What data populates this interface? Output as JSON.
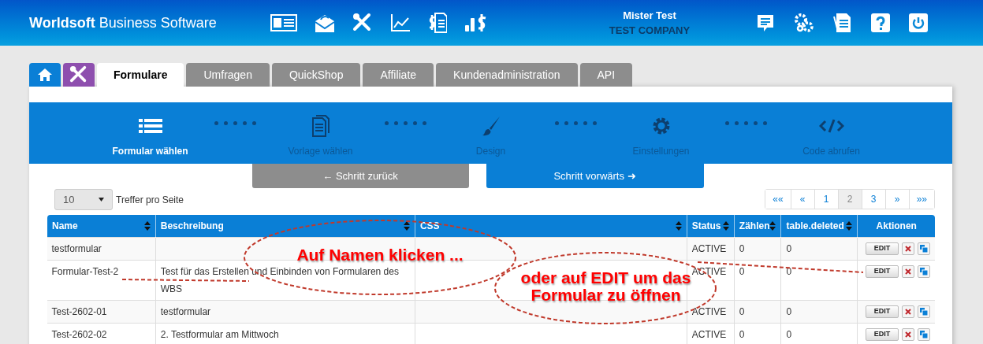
{
  "header": {
    "title": "**Worldsoft** Business Software",
    "user_name": "Mister Test",
    "company": "TEST COMPANY"
  },
  "tabs": [
    {
      "kind": "home",
      "selected": false
    },
    {
      "kind": "tools",
      "selected": false
    },
    {
      "kind": "text",
      "label": "Formulare",
      "selected": true
    },
    {
      "kind": "text",
      "label": "Umfragen",
      "selected": false
    },
    {
      "kind": "text",
      "label": "QuickShop",
      "selected": false
    },
    {
      "kind": "text",
      "label": "Affiliate",
      "selected": false
    },
    {
      "kind": "text",
      "label": "Kundenadministration",
      "selected": false
    },
    {
      "kind": "text",
      "label": "API",
      "selected": false
    }
  ],
  "wizard": {
    "steps": [
      {
        "kind": "list",
        "label": "Formular wählen",
        "selected": true
      },
      {
        "kind": "documents",
        "label": "Vorlage wählen",
        "selected": false
      },
      {
        "kind": "brush",
        "label": "Design",
        "selected": false
      },
      {
        "kind": "gear",
        "label": "Einstellungen",
        "selected": false
      },
      {
        "kind": "code",
        "label": "Code abrufen",
        "selected": false
      }
    ],
    "back_button": "← Schritt zurück",
    "forward_button": "Schritt vorwärts ➜"
  },
  "per_page": {
    "value": "10",
    "label": "Treffer pro Seite"
  },
  "pagination": [
    {
      "label": "««",
      "selected": false
    },
    {
      "label": "«",
      "selected": false
    },
    {
      "label": "1",
      "selected": false
    },
    {
      "label": "2",
      "selected": true
    },
    {
      "label": "3",
      "selected": false
    },
    {
      "label": "»",
      "selected": false
    },
    {
      "label": "»»",
      "selected": false
    }
  ],
  "table": {
    "columns": [
      {
        "label": "Name",
        "sortable": true
      },
      {
        "label": "Beschreibung",
        "sortable": true
      },
      {
        "label": "CSS",
        "sortable": true
      },
      {
        "label": "Status",
        "sortable": true
      },
      {
        "label": "Zählen",
        "sortable": true
      },
      {
        "label": "table.deleted",
        "sortable": true
      },
      {
        "label": "Aktionen",
        "sortable": false
      }
    ],
    "rows": [
      {
        "name": "testformular",
        "status": "ACTIVE",
        "count": "0",
        "deleted": "0",
        "edit": "EDIT"
      },
      {
        "name": "Formular-Test-2",
        "description": "Test für das Erstellen und Einbinden von Formularen des WBS",
        "status": "ACTIVE",
        "count": "0",
        "deleted": "0",
        "edit": "EDIT"
      },
      {
        "name": "Test-2602-01",
        "description": "testformular",
        "status": "ACTIVE",
        "count": "0",
        "deleted": "0",
        "edit": "EDIT"
      },
      {
        "name": "Test-2602-02",
        "description": "2. Testformular am Mittwoch",
        "status": "ACTIVE",
        "count": "0",
        "deleted": "0",
        "edit": "EDIT"
      }
    ]
  },
  "callouts": [
    {
      "lines": [
        "Auf Namen klicken ..."
      ]
    },
    {
      "lines": [
        "oder auf EDIT um das",
        "Formular zu öffnen"
      ]
    }
  ]
}
